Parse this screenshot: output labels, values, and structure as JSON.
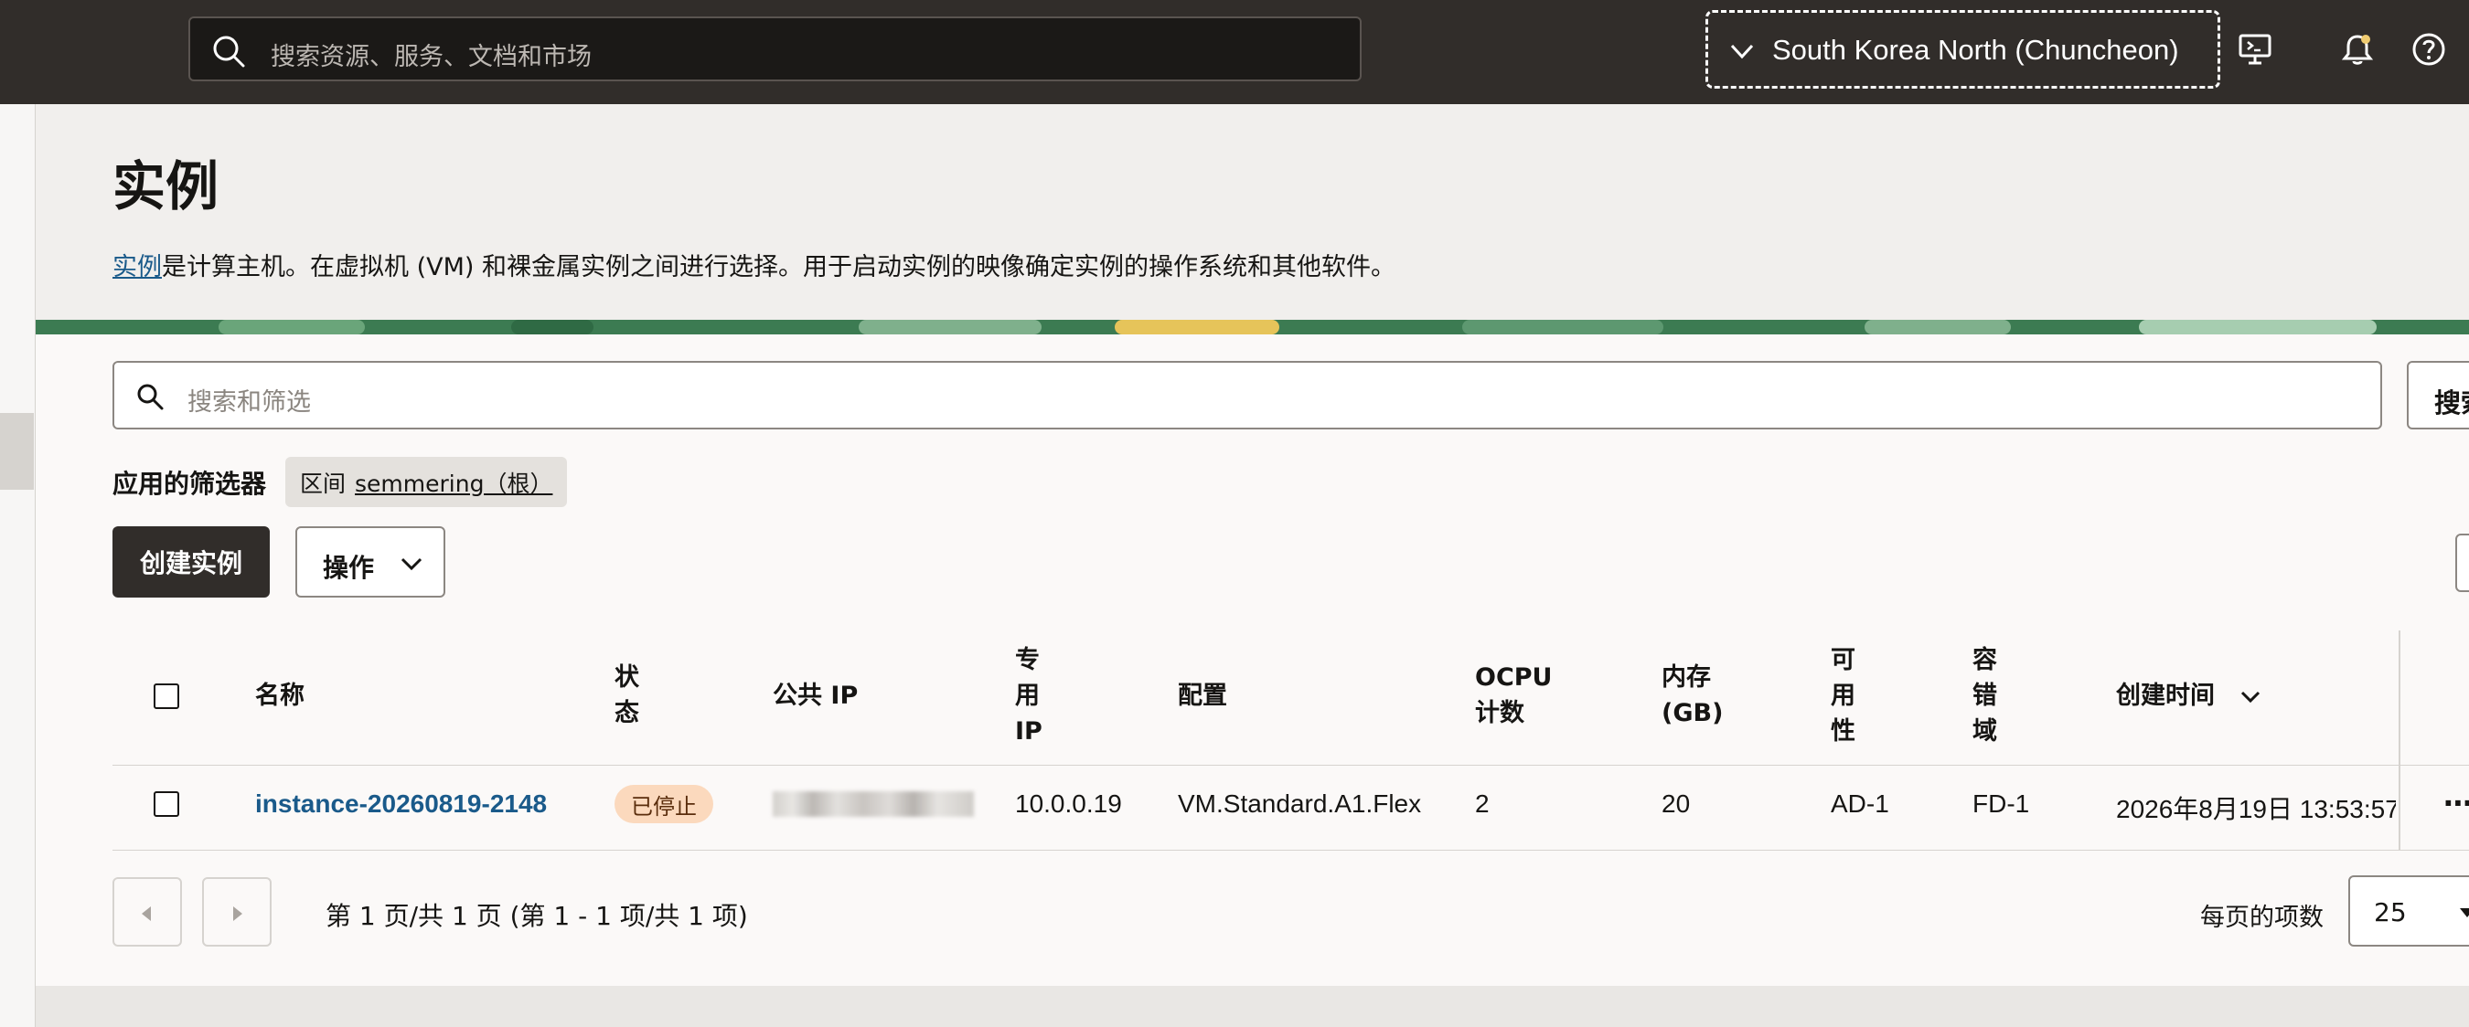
{
  "topbar": {
    "search_placeholder": "搜索资源、服务、文档和市场",
    "region": "South Korea North (Chuncheon)"
  },
  "header": {
    "title": "实例",
    "description_link": "实例",
    "description_rest": "是计算主机。在虚拟机 (VM) 和裸金属实例之间进行选择。用于启动实例的映像确定实例的操作系统和其他软件。"
  },
  "filters": {
    "search_placeholder": "搜索和筛选",
    "search_button": "搜索",
    "applied_label": "应用的筛选器",
    "chip_key": "区间",
    "chip_value": "semmering（根）"
  },
  "actions": {
    "create": "创建实例",
    "actions": "操作"
  },
  "table": {
    "headers": {
      "name": "名称",
      "status": "状\n态",
      "public_ip": "公共 IP",
      "private_ip": "专\n用\nIP",
      "shape": "配置",
      "ocpu": "OCPU\n计数",
      "memory": "内存\n(GB)",
      "ad": "可\n用\n性",
      "fd": "容\n错\n域",
      "created": "创建时间"
    },
    "rows": [
      {
        "name": "instance-20260819-2148",
        "status": "已停止",
        "private_ip": "10.0.0.19",
        "shape": "VM.Standard.A1.Flex",
        "ocpu": "2",
        "memory": "20",
        "ad": "AD-1",
        "fd": "FD-1",
        "created": "2026年8月19日 13:53:57"
      }
    ]
  },
  "pagination": {
    "summary": "第 1 页/共 1 页 (第 1 - 1 项/共 1 项)",
    "per_page_label": "每页的项数",
    "per_page_value": "25"
  },
  "colors": {
    "topbar": "#312d2a",
    "link": "#1a5a8a",
    "status_stopped_bg": "#fbd9bd",
    "primary_button": "#312d2a"
  }
}
